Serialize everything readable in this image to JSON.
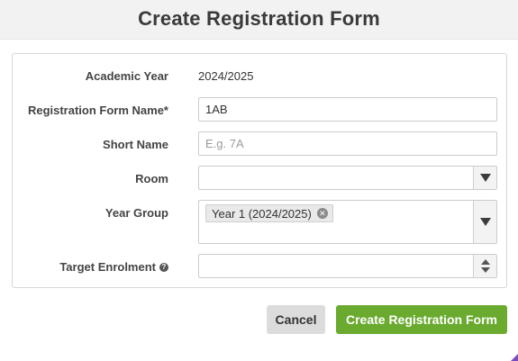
{
  "dialog": {
    "title": "Create Registration Form"
  },
  "form": {
    "academic_year": {
      "label": "Academic Year",
      "value": "2024/2025"
    },
    "name": {
      "label": "Registration Form Name*",
      "value": "1AB"
    },
    "short_name": {
      "label": "Short Name",
      "value": "",
      "placeholder": "E.g. 7A"
    },
    "room": {
      "label": "Room",
      "value": ""
    },
    "year_group": {
      "label": "Year Group",
      "selected": [
        "Year 1 (2024/2025)"
      ],
      "remove_icon": "x-circle-icon"
    },
    "target_enrolment": {
      "label": "Target Enrolment",
      "value": "",
      "help_icon": "question-circle-icon"
    }
  },
  "actions": {
    "cancel_label": "Cancel",
    "create_label": "Create Registration Form"
  },
  "colors": {
    "primary": "#6aaa2f",
    "header_bg": "#f2f2f2"
  }
}
